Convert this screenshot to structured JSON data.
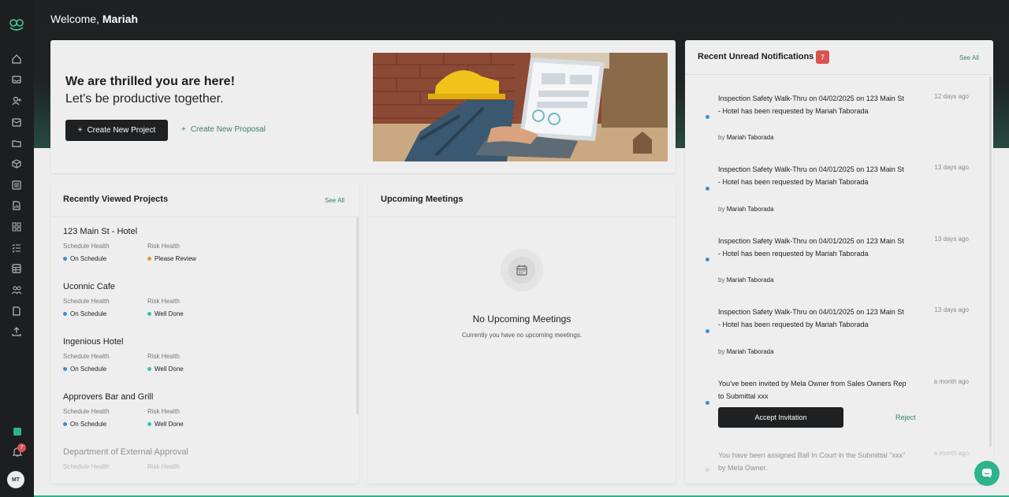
{
  "header": {
    "welcome_prefix": "Welcome,",
    "user_name": "Mariah"
  },
  "sidebar": {
    "avatar_initials": "MT",
    "bell_count": "7"
  },
  "hero": {
    "heading": "We are thrilled you are here!",
    "subheading": "Let's be productive together.",
    "primary_button": "Create New Project",
    "secondary_link": "Create New Proposal"
  },
  "recent_projects": {
    "title": "Recently Viewed Projects",
    "see_all": "See All",
    "schedule_label": "Schedule Health",
    "risk_label": "Risk Health",
    "items": [
      {
        "name": "123 Main St - Hotel",
        "schedule": "On Schedule",
        "risk": "Please Review"
      },
      {
        "name": "Uconnic Cafe",
        "schedule": "On Schedule",
        "risk": "Well Done"
      },
      {
        "name": "Ingenious Hotel",
        "schedule": "On Schedule",
        "risk": "Well Done"
      },
      {
        "name": "Approvers Bar and Grill",
        "schedule": "On Schedule",
        "risk": "Well Done"
      },
      {
        "name": "Department of External Approval",
        "schedule": "",
        "risk": ""
      }
    ]
  },
  "meetings": {
    "title": "Upcoming Meetings",
    "empty_title": "No Upcoming Meetings",
    "empty_sub": "Currently you have no upcoming meetings."
  },
  "notifications": {
    "title": "Recent Unread Notifications",
    "count": "7",
    "see_all": "See All",
    "by_prefix": "by",
    "items": [
      {
        "text": "Inspection Safety Walk-Thru on 04/02/2025 on 123 Main St - Hotel has been requested by Mariah Taborada",
        "by": "Mariah Taborada",
        "time": "12 days ago"
      },
      {
        "text": "Inspection Safety Walk-Thru on 04/01/2025 on 123 Main St - Hotel has been requested by Mariah Taborada",
        "by": "Mariah Taborada",
        "time": "13 days ago"
      },
      {
        "text": "Inspection Safety Walk-Thru on 04/01/2025 on 123 Main St - Hotel has been requested by Mariah Taborada",
        "by": "Mariah Taborada",
        "time": "13 days ago"
      },
      {
        "text": "Inspection Safety Walk-Thru on 04/01/2025 on 123 Main St - Hotel has been requested by Mariah Taborada",
        "by": "Mariah Taborada",
        "time": "13 days ago"
      },
      {
        "text": "You've been invited by Mela Owner from Sales Owners Rep to Submittal xxx",
        "time": "a month ago",
        "accept": "Accept Invitation",
        "reject": "Reject"
      },
      {
        "text": "You have been assigned Ball In Court in the Submittal \"xxx\" by Mela Owner.",
        "time": "a month ago"
      }
    ]
  },
  "colors": {
    "accent": "#2fb38a",
    "link": "#3c7f6c",
    "badge": "#d9534f",
    "dark": "#1f2021"
  }
}
